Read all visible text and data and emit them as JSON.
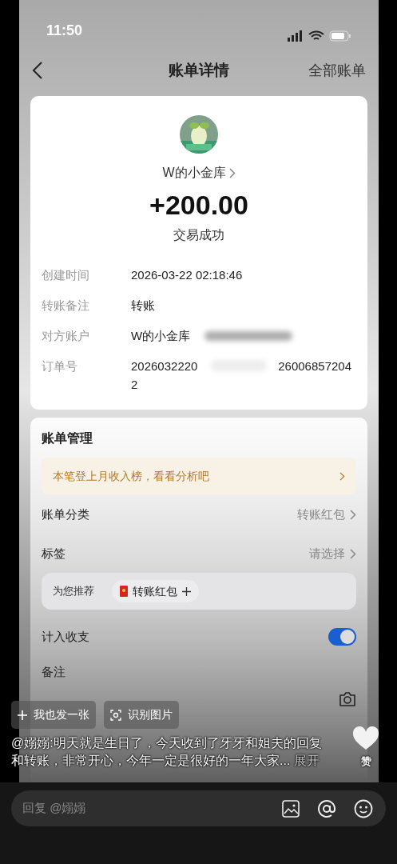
{
  "status_bar": {
    "time": "11:50"
  },
  "nav": {
    "title": "账单详情",
    "right": "全部账单"
  },
  "bill": {
    "payer": "W的小金库",
    "amount": "+200.00",
    "status": "交易成功",
    "details": [
      {
        "label": "创建时间",
        "value": "2026-03-22 02:18:46",
        "blurred": false
      },
      {
        "label": "转账备注",
        "value": "转账",
        "blurred": false
      },
      {
        "label": "对方账户",
        "value": "W的小金库",
        "blurred": true
      },
      {
        "label": "订单号",
        "value": "2026032220",
        "value_end": "26006857204",
        "value_wrap": "2",
        "blurred": true
      }
    ]
  },
  "management": {
    "title": "账单管理",
    "banner": "本笔登上月收入榜，看看分析吧",
    "rows": [
      {
        "kind": "link",
        "label": "账单分类",
        "value": "转账红包"
      },
      {
        "kind": "link",
        "label": "标签",
        "value": "请选择"
      },
      {
        "kind": "suggest",
        "label": "为您推荐",
        "tag": "转账红包"
      },
      {
        "kind": "toggle",
        "label": "计入收支",
        "on": true
      },
      {
        "kind": "plain",
        "label": "备注"
      }
    ]
  },
  "overlay": {
    "buttons": [
      {
        "kind": "add",
        "label": "我也发一张"
      },
      {
        "kind": "scan",
        "label": "识别图片"
      }
    ],
    "caption": "@嫋嫋:明天就是生日了，今天收到了牙牙和姐夫的回复和转账，非常开心，今年一定是很好的一年大家...",
    "expand": "展开",
    "like": "赞"
  },
  "reply": {
    "placeholder": "回复 @嫋嫋"
  }
}
